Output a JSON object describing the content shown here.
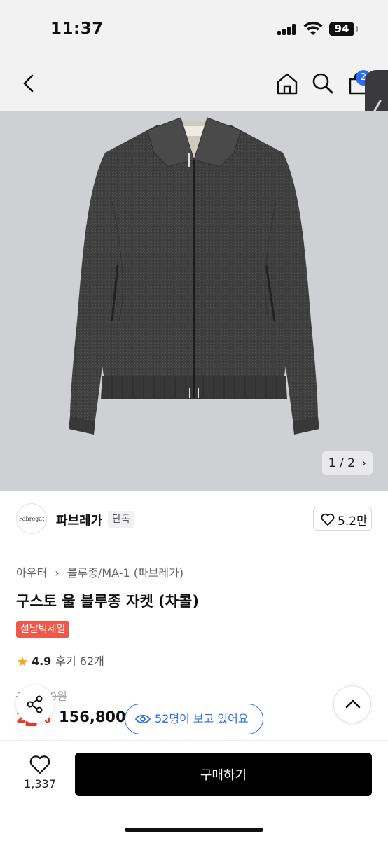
{
  "status_bar": {
    "time": "11:37",
    "battery": "94"
  },
  "nav": {
    "cart_count": "2"
  },
  "gallery": {
    "page_indicator": "1 / 2"
  },
  "brand": {
    "logo_text": "Fabrégat",
    "name": "파브레가",
    "tag": "단독",
    "likes": "5.2만"
  },
  "breadcrumb": {
    "level1": "아우터",
    "level2": "블루종/MA-1 (파브레가)"
  },
  "product": {
    "title": "구스토 울 블루종 자켓 (차콜)",
    "event_tag": "설날빅세일",
    "rating": "4.9",
    "reviews_label": "후기 62개",
    "original_price": "1█,000원",
    "discount_label": "2█%",
    "price": "156,800"
  },
  "viewers_label": "52명이 보고 있어요",
  "bottom_bar": {
    "wish_count": "1,337",
    "buy_label": "구매하기"
  },
  "icons": [
    "back-icon",
    "home-icon",
    "search-icon",
    "cart-icon",
    "share-icon",
    "chevron-up-icon",
    "eye-icon",
    "heart-icon",
    "star-icon"
  ],
  "colors": {
    "accent_blue": "#2b6df0",
    "sale_red": "#ee5a4a",
    "star": "#f5a623",
    "buy_button": "#000000"
  }
}
